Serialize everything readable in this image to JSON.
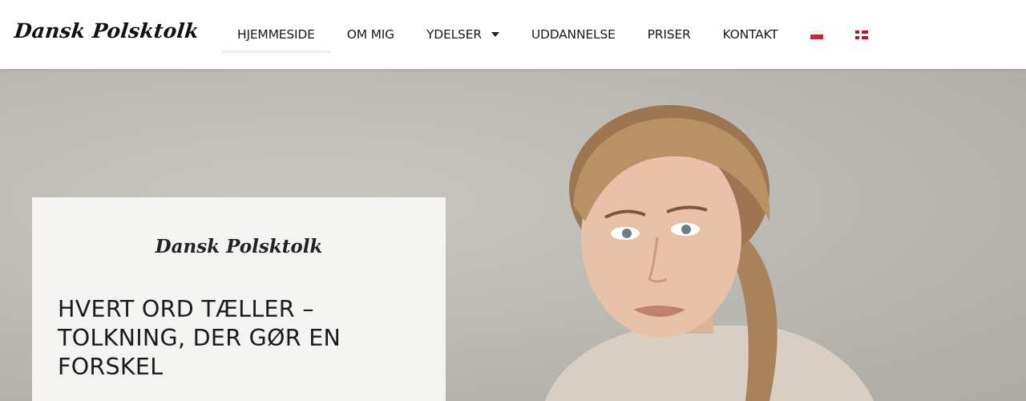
{
  "header": {
    "logo": "Dansk Polsktolk",
    "nav": [
      {
        "label": "HJEMMESIDE"
      },
      {
        "label": "OM MIG"
      },
      {
        "label": "YDELSER"
      },
      {
        "label": "UDDANNELSE"
      },
      {
        "label": "PRISER"
      },
      {
        "label": "KONTAKT"
      }
    ],
    "languages": [
      "polish-flag-icon",
      "danish-flag-icon"
    ]
  },
  "hero": {
    "card_logo": "Dansk Polsktolk",
    "title": "HVERT ORD TÆLLER – TOLKNING, DER GØR EN FORSKEL"
  }
}
